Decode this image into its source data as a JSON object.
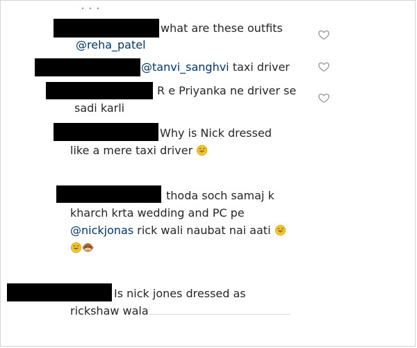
{
  "comments": [
    {
      "id": "c1",
      "line1": "what are these outfits",
      "line2_mention": "@reha_patel",
      "liked_icon": "heart-outline-icon"
    },
    {
      "id": "c2",
      "mention": "@tanvi_sanghvi",
      "text": " taxi driver",
      "liked_icon": "heart-outline-icon"
    },
    {
      "id": "c3",
      "line1": "R e Priyanka ne driver se",
      "line2": "sadi karli",
      "liked_icon": "heart-outline-icon"
    },
    {
      "id": "c4",
      "line1": "Why is Nick dressed",
      "line2": "like a mere taxi driver",
      "emoji": "grinning-sweat-emoji"
    },
    {
      "id": "c5",
      "line1": "thoda soch samaj k",
      "line2": "kharch krta wedding and PC pe",
      "line3_mention": "@nickjonas",
      "line3_text": " rick wali naubat nai aati",
      "emojis": [
        "grinning-sweat-emoji",
        "grinning-sweat-emoji",
        "see-no-evil-monkey-emoji"
      ]
    },
    {
      "id": "c6",
      "line1": "Is nick jones dressed as",
      "line2": "rickshaw wala"
    }
  ]
}
